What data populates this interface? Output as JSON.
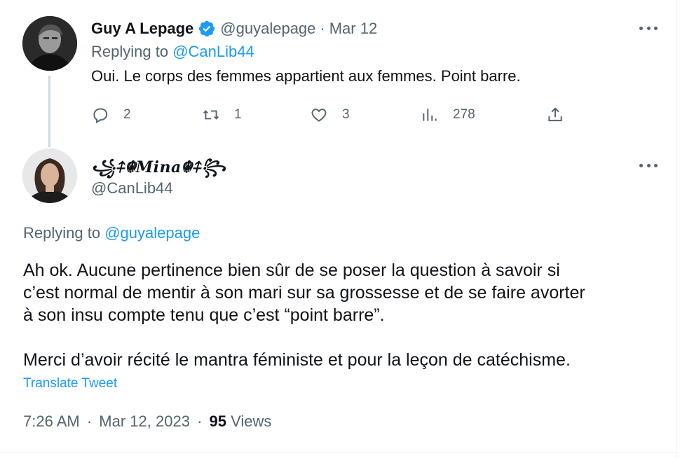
{
  "colors": {
    "link": "#1d9bf0",
    "muted": "#536471",
    "text": "#0f1419",
    "thread": "#cfd9de"
  },
  "tweet1": {
    "name": "Guy A Lepage",
    "handle": "@guyalepage",
    "separator": "·",
    "date": "Mar 12",
    "replying_prefix": "Replying to",
    "replying_to": "@CanLib44",
    "text": "Oui. Le corps des femmes appartient aux femmes. Point barre.",
    "verified_icon": "verified-badge-icon",
    "actions": {
      "replies": "2",
      "retweets": "1",
      "likes": "3",
      "views": "278"
    }
  },
  "tweet2": {
    "name": "꧁⍏☬𝑴𝒊𝒏𝒂☬⍏꧂",
    "handle": "@CanLib44",
    "replying_prefix": "Replying to",
    "replying_to": "@guyalepage",
    "paragraphs": [
      "Ah ok. Aucune pertinence bien sûr de se poser la question à savoir si",
      "c’est normal de mentir à son mari sur sa grossesse et de se faire avorter",
      "à son insu compte tenu que c’est “point barre”.",
      "Merci d’avoir récité le mantra féministe et pour la leçon de catéchisme."
    ],
    "translate": "Translate Tweet",
    "time": "7:26 AM",
    "separator": "·",
    "full_date": "Mar 12, 2023",
    "views_count": "95",
    "views_label": "Views"
  }
}
